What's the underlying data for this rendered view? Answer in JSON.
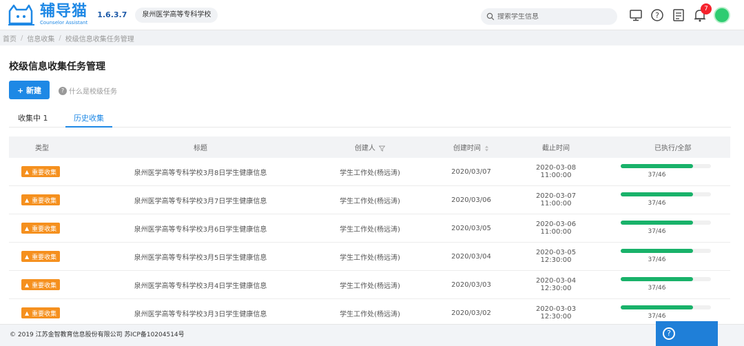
{
  "header": {
    "logo_text": "辅导猫",
    "logo_sub": "Counselor Assistant",
    "version": "1.6.3.7",
    "school": "泉州医学高等专科学校",
    "search_placeholder": "搜索学生信息",
    "notification_count": "7"
  },
  "breadcrumb": [
    "首页",
    "信息收集",
    "校级信息收集任务管理"
  ],
  "page": {
    "title": "校级信息收集任务管理",
    "new_button": "+ 新建",
    "help_link": "什么是校级任务"
  },
  "tabs": [
    {
      "label": "收集中 1",
      "active": false
    },
    {
      "label": "历史收集",
      "active": true
    }
  ],
  "table": {
    "headers": {
      "type": "类型",
      "title": "标题",
      "creator": "创建人",
      "created": "创建时间",
      "deadline": "截止时间",
      "progress": "已执行/全部"
    },
    "rows": [
      {
        "type": "重要收集",
        "title": "泉州医学高等专科学校3月8日学生健康信息",
        "creator": "学生工作处(杨远涛)",
        "created": "2020/03/07",
        "deadline": "2020-03-08 11:00:00",
        "progress_text": "37/46",
        "progress": 0.8
      },
      {
        "type": "重要收集",
        "title": "泉州医学高等专科学校3月7日学生健康信息",
        "creator": "学生工作处(杨远涛)",
        "created": "2020/03/06",
        "deadline": "2020-03-07 11:00:00",
        "progress_text": "37/46",
        "progress": 0.8
      },
      {
        "type": "重要收集",
        "title": "泉州医学高等专科学校3月6日学生健康信息",
        "creator": "学生工作处(杨远涛)",
        "created": "2020/03/05",
        "deadline": "2020-03-06 11:00:00",
        "progress_text": "37/46",
        "progress": 0.8
      },
      {
        "type": "重要收集",
        "title": "泉州医学高等专科学校3月5日学生健康信息",
        "creator": "学生工作处(杨远涛)",
        "created": "2020/03/04",
        "deadline": "2020-03-05 12:30:00",
        "progress_text": "37/46",
        "progress": 0.8
      },
      {
        "type": "重要收集",
        "title": "泉州医学高等专科学校3月4日学生健康信息",
        "creator": "学生工作处(杨远涛)",
        "created": "2020/03/03",
        "deadline": "2020-03-04 12:30:00",
        "progress_text": "37/46",
        "progress": 0.8
      },
      {
        "type": "重要收集",
        "title": "泉州医学高等专科学校3月3日学生健康信息",
        "creator": "学生工作处(杨远涛)",
        "created": "2020/03/02",
        "deadline": "2020-03-03 12:30:00",
        "progress_text": "37/46",
        "progress": 0.8
      }
    ]
  },
  "footer": {
    "copyright": "© 2019 江苏金智教育信息股份有限公司 苏ICP备10204514号"
  },
  "colors": {
    "primary": "#1e88e5",
    "tag": "#f5901e",
    "progress": "#19b26a",
    "badge": "#f5222d"
  }
}
